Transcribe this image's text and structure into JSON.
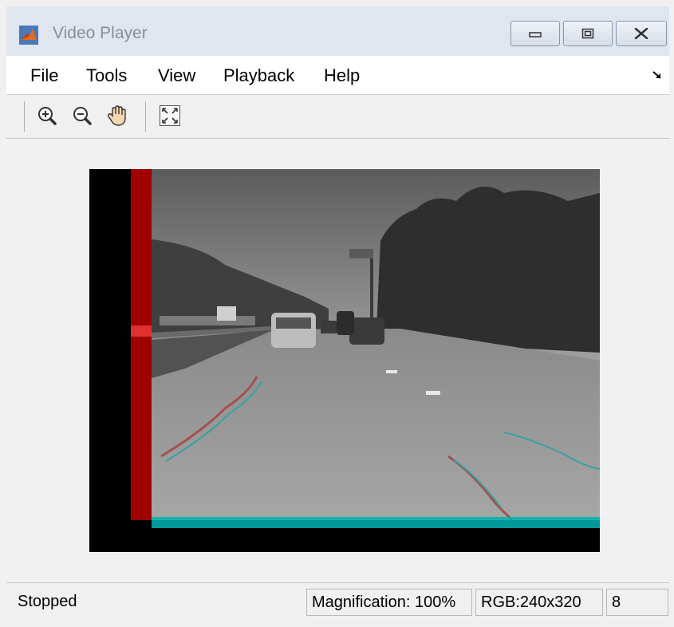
{
  "window": {
    "title": "Video Player"
  },
  "menu": {
    "items": [
      {
        "label": "File"
      },
      {
        "label": "Tools"
      },
      {
        "label": "View"
      },
      {
        "label": "Playback"
      },
      {
        "label": "Help"
      }
    ]
  },
  "toolbar": {
    "icons": [
      "zoom-in-icon",
      "zoom-out-icon",
      "pan-hand-icon",
      "fit-to-window-icon"
    ]
  },
  "status": {
    "state": "Stopped",
    "magnification": "Magnification: 100%",
    "format": "RGB:240x320",
    "frame": "8"
  },
  "colors": {
    "titlebar": "#dfe6f0",
    "red_channel": "#b00000",
    "cyan_channel": "#00b3b3"
  }
}
